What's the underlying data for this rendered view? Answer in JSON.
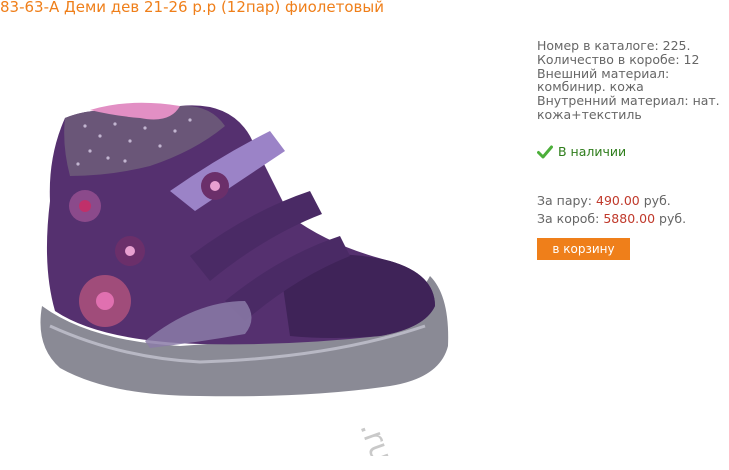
{
  "product": {
    "title": "83-63-А Деми дев 21-26 р.р (12пар) фиолетовый",
    "watermark": ".ru",
    "info_lines": [
      "Номер в каталоге: 225.",
      "Количество в коробе: 12",
      "Внешний материал:",
      "комбинир. кожа",
      "Внутренний материал: нат.",
      "кожа+текстиль"
    ],
    "stock_icon": "check-icon",
    "stock_text": "В наличии",
    "price_pair_label": "За пару:",
    "price_pair_value": "490.00",
    "price_box_label": "За короб:",
    "price_box_value": "5880.00",
    "currency": "руб.",
    "cart_button": "в корзину"
  },
  "colors": {
    "title": "#ef7f1a",
    "button": "#ef7f1a",
    "price": "#c0392b",
    "stock": "#2e7d1b"
  }
}
